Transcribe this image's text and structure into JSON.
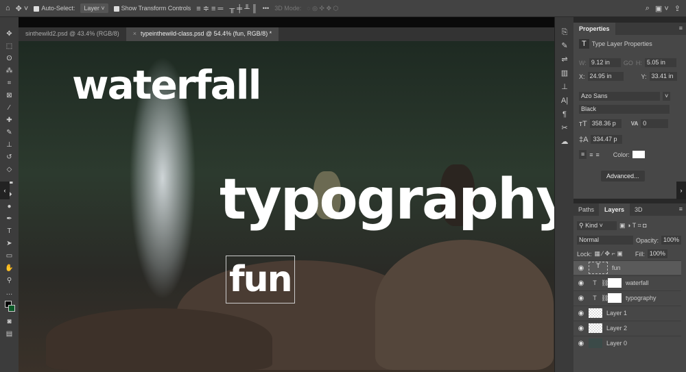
{
  "options_bar": {
    "auto_select_label": "Auto-Select:",
    "auto_select_value": "Layer",
    "show_transform_label": "Show Transform Controls",
    "more": "•••",
    "mode_3d": "3D Mode:"
  },
  "tabs": [
    {
      "label": "sinthewild2.psd @ 43.4% (RGB/8)"
    },
    {
      "label": "typeinthewild-class.psd @ 54.4% (fun, RGB/8) *",
      "close": "×"
    }
  ],
  "canvas": {
    "texts": [
      "waterfall",
      "typography",
      "fun"
    ]
  },
  "properties": {
    "title": "Properties",
    "subtitle": "Type Layer Properties",
    "w_label": "W:",
    "w_value": "9.12 in",
    "go_label": "GO",
    "h_label": "H:",
    "h_value": "5.05 in",
    "x_label": "X:",
    "x_value": "24.95 in",
    "y_label": "Y:",
    "y_value": "33.41 in",
    "font_family": "Azo Sans",
    "font_style": "Black",
    "font_size": "358.36 p",
    "tracking": "0",
    "leading": "334.47 p",
    "color_label": "Color:",
    "text_color": "#ffffff",
    "advanced": "Advanced..."
  },
  "layers_panel": {
    "tabs": [
      "Paths",
      "Layers",
      "3D"
    ],
    "filter": "Kind",
    "blend_mode": "Normal",
    "opacity_label": "Opacity:",
    "opacity": "100%",
    "lock_label": "Lock:",
    "fill_label": "Fill:",
    "fill": "100%",
    "layers": [
      {
        "name": "fun",
        "type": "text",
        "selected": true
      },
      {
        "name": "waterfall",
        "type": "text"
      },
      {
        "name": "typography",
        "type": "text"
      },
      {
        "name": "Layer 1",
        "type": "pixel"
      },
      {
        "name": "Layer 2",
        "type": "pixel"
      },
      {
        "name": "Layer 0",
        "type": "image"
      }
    ]
  }
}
